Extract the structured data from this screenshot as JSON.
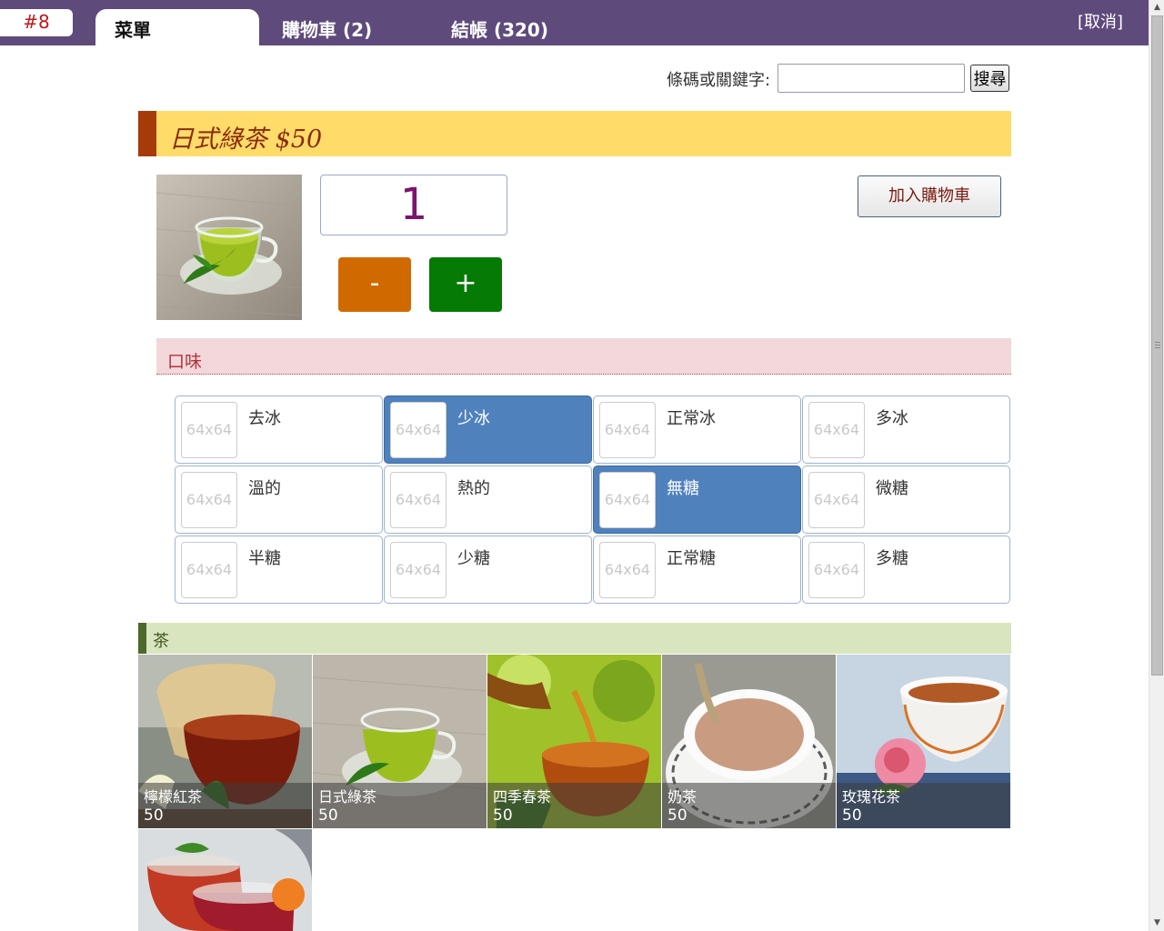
{
  "header": {
    "order_number": "#8",
    "tabs": [
      {
        "label": "菜單",
        "active": true
      },
      {
        "label": "購物車 (2)",
        "active": false
      },
      {
        "label": "結帳 (320)",
        "active": false
      }
    ],
    "cancel_label": "[取消]"
  },
  "search": {
    "label": "條碼或關鍵字:",
    "value": "",
    "button_label": "搜尋"
  },
  "product": {
    "title": "日式綠茶 $50",
    "quantity": "1",
    "minus_label": "-",
    "plus_label": "+",
    "add_to_cart_label": "加入購物車"
  },
  "flavor": {
    "title": "口味",
    "thumb_placeholder": "64x64",
    "options": [
      {
        "label": "去冰",
        "selected": false
      },
      {
        "label": "少冰",
        "selected": true
      },
      {
        "label": "正常冰",
        "selected": false
      },
      {
        "label": "多冰",
        "selected": false
      },
      {
        "label": "溫的",
        "selected": false
      },
      {
        "label": "熱的",
        "selected": false
      },
      {
        "label": "無糖",
        "selected": true
      },
      {
        "label": "微糖",
        "selected": false
      },
      {
        "label": "半糖",
        "selected": false
      },
      {
        "label": "少糖",
        "selected": false
      },
      {
        "label": "正常糖",
        "selected": false
      },
      {
        "label": "多糖",
        "selected": false
      }
    ]
  },
  "tea": {
    "title": "茶",
    "items": [
      {
        "name": "檸檬紅茶",
        "price": "50"
      },
      {
        "name": "日式綠茶",
        "price": "50"
      },
      {
        "name": "四季春茶",
        "price": "50"
      },
      {
        "name": "奶茶",
        "price": "50"
      },
      {
        "name": "玫瑰花茶",
        "price": "50"
      }
    ]
  },
  "colors": {
    "topbar": "#5f4a7c",
    "selected_option": "#4f81bd",
    "minus_button": "#d06a00",
    "plus_button": "#057a05"
  }
}
